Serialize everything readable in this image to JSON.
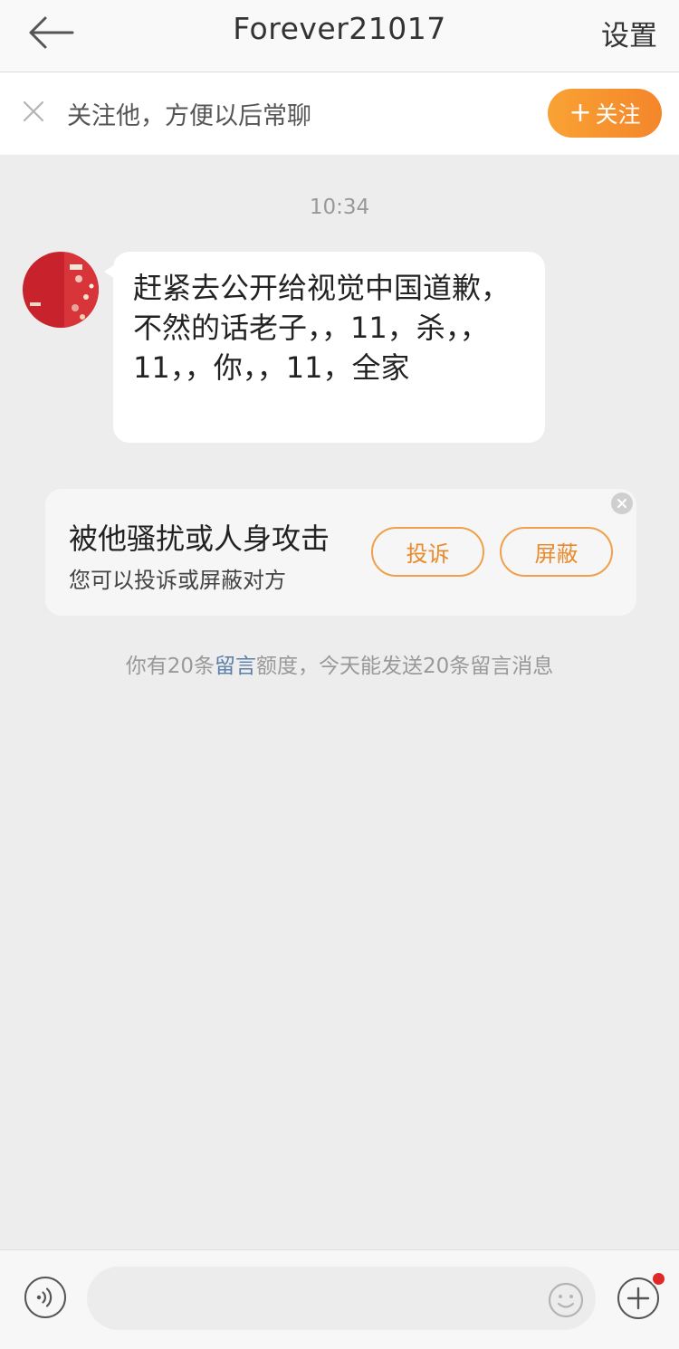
{
  "header": {
    "title": "Forever21017",
    "settings_label": "设置",
    "back_icon": "arrow-left-icon"
  },
  "follow_bar": {
    "text": "关注他，方便以后常聊",
    "button_plus": "+",
    "button_label": "关注",
    "close_icon": "close-icon"
  },
  "chat": {
    "time": "10:34",
    "message": "赶紧去公开给视觉中国道歉，不然的话老子，，11，杀，，11，，你，，11，全家"
  },
  "harass_card": {
    "title": "被他骚扰或人身攻击",
    "subtitle": "您可以投诉或屏蔽对方",
    "report_label": "投诉",
    "block_label": "屏蔽"
  },
  "quota": {
    "prefix": "你有20条",
    "link": "留言",
    "suffix": "额度，今天能发送20条留言消息"
  },
  "bottom_bar": {
    "input_value": "",
    "input_placeholder": "",
    "icons": [
      "voice-icon",
      "emoji-icon",
      "plus-icon"
    ]
  },
  "colors": {
    "accent": "#f4862a",
    "link": "#5a7ea8",
    "background": "#ededed",
    "notification_dot": "#e02828"
  }
}
